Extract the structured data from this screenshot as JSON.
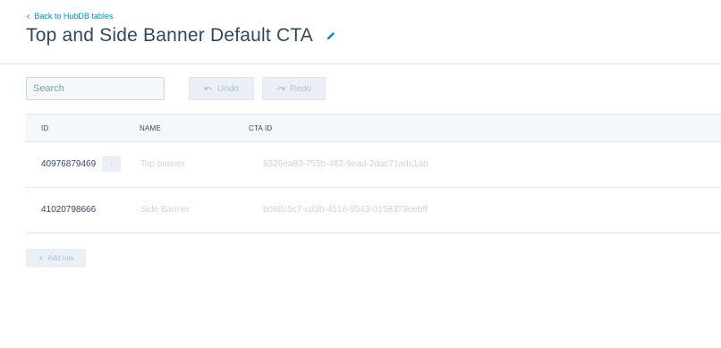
{
  "nav": {
    "back_chevron": "‹",
    "back_label": "Back to HubDB tables"
  },
  "header": {
    "title": "Top and Side Banner Default CTA",
    "edit_icon": "pencil-icon"
  },
  "toolbar": {
    "search_placeholder": "Search",
    "undo_label": "Undo",
    "redo_label": "Redo"
  },
  "table": {
    "columns": {
      "id": "ID",
      "name": "NAME",
      "cta_id": "CTA ID"
    },
    "rows": [
      {
        "id": "40976879469",
        "menu": "·",
        "name": "Top banner",
        "cta_id": "8326ea83-755b-4ff2-9ead-2dac71adc1ab"
      },
      {
        "id": "41020798666",
        "name": "Side Banner",
        "cta_id": "b088c5c7-cd3b-4516-9543-0158379eebff"
      }
    ]
  },
  "footer": {
    "add_row_icon": "+",
    "add_row_label": "Add row"
  },
  "colors": {
    "accent": "#0091ae",
    "text": "#33475b",
    "muted": "#cbd6e2",
    "border": "#dfe3eb"
  }
}
